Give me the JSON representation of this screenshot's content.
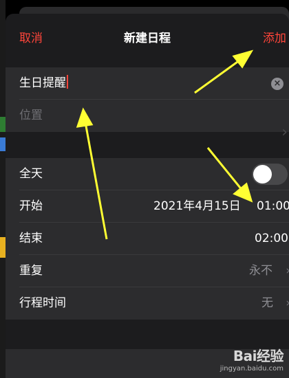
{
  "background": {
    "colors": [
      "#3a7bd5",
      "#e8b120",
      "#c0392b",
      "#2e7d32",
      "#555555"
    ]
  },
  "nav": {
    "cancel": "取消",
    "title": "新建日程",
    "add": "添加"
  },
  "form": {
    "title_value": "生日提醒",
    "location_placeholder": "位置"
  },
  "schedule": {
    "all_day_label": "全天",
    "all_day_on": false,
    "start_label": "开始",
    "start_date": "2021年4月15日",
    "start_time": "01:00",
    "end_label": "结束",
    "end_time": "02:00",
    "repeat_label": "重复",
    "repeat_value": "永不",
    "travel_label": "行程时间",
    "travel_value": "无"
  },
  "icons": {
    "clear": "clear-circle-icon",
    "chevron": "chevron-right-icon"
  },
  "watermark": {
    "logo": "Bai经验",
    "url": "jingyan.baidu.com"
  },
  "colors": {
    "accent": "#ff453a",
    "sheet": "#1c1c1e",
    "group": "#2c2c2e",
    "annotation_arrow": "#ffff33"
  }
}
